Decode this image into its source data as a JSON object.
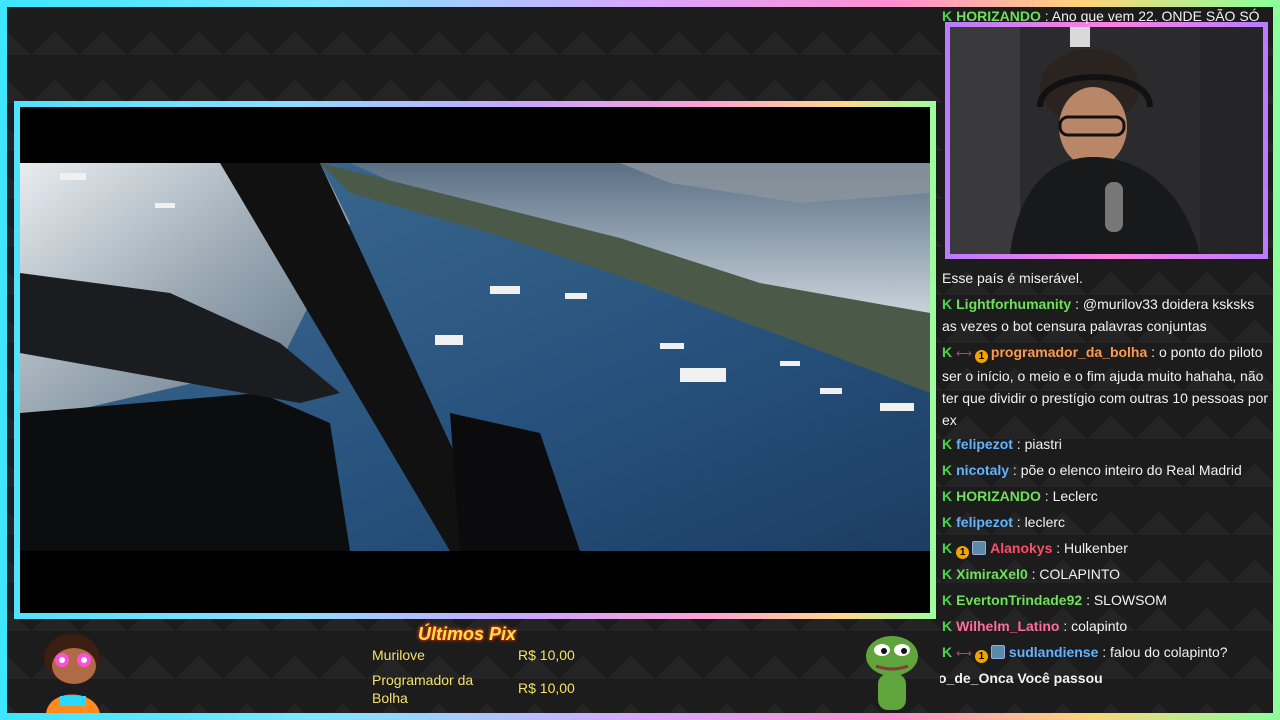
{
  "colors": {
    "accent_green": "#4ed34e",
    "pix_yellow": "#ffe04a"
  },
  "chat": {
    "lines": [
      {
        "user": "HORIZANDO",
        "user_color": "#6ee05a",
        "msg": ": Ano que vem 22. ONDE SÃO SÓ"
      },
      {
        "user": "",
        "user_color": "#ffffff",
        "msg": "Esse país é miserável."
      },
      {
        "user": "Lightforhumanity",
        "user_color": "#6ee05a",
        "msg": ": @murilov33 doidera ksksks as vezes o bot censura palavras conjuntas"
      },
      {
        "user": "programador_da_bolha",
        "user_color": "#ff9a4d",
        "msg": ": o ponto do piloto ser o início, o meio e o fim ajuda muito hahaha, não ter que dividir o prestígio com outras 10 pessoas por ex"
      },
      {
        "user": "felipezot",
        "user_color": "#63b3ff",
        "msg": ": piastri"
      },
      {
        "user": "nicotaly",
        "user_color": "#63b3ff",
        "msg": ": põe o elenco inteiro do Real Madrid"
      },
      {
        "user": "HORIZANDO",
        "user_color": "#6ee05a",
        "msg": ": Leclerc"
      },
      {
        "user": "felipezot",
        "user_color": "#63b3ff",
        "msg": ": leclerc"
      },
      {
        "user": "Alanokys",
        "user_color": "#ff4d6a",
        "msg": ": Hulkenber"
      },
      {
        "user": "XimiraXel0",
        "user_color": "#6ee05a",
        "msg": ": COLAPINTO"
      },
      {
        "user": "EvertonTrindade92",
        "user_color": "#6ee05a",
        "msg": ": SLOWSOM"
      },
      {
        "user": "Wilhelm_Latino",
        "user_color": "#ff6b9a",
        "msg": ": colapinto"
      },
      {
        "user": "sudlandiense",
        "user_color": "#63b3ff",
        "msg": ": falou do colapinto?"
      }
    ],
    "badge_number": "1"
  },
  "alert_ticker": "o_de_Onca Você passou",
  "pix": {
    "title": "Últimos Pix",
    "rows": [
      {
        "name": "Murilove",
        "amount": "R$ 10,00"
      },
      {
        "name": "Programador da Bolha",
        "amount": "R$ 10,00"
      }
    ]
  }
}
